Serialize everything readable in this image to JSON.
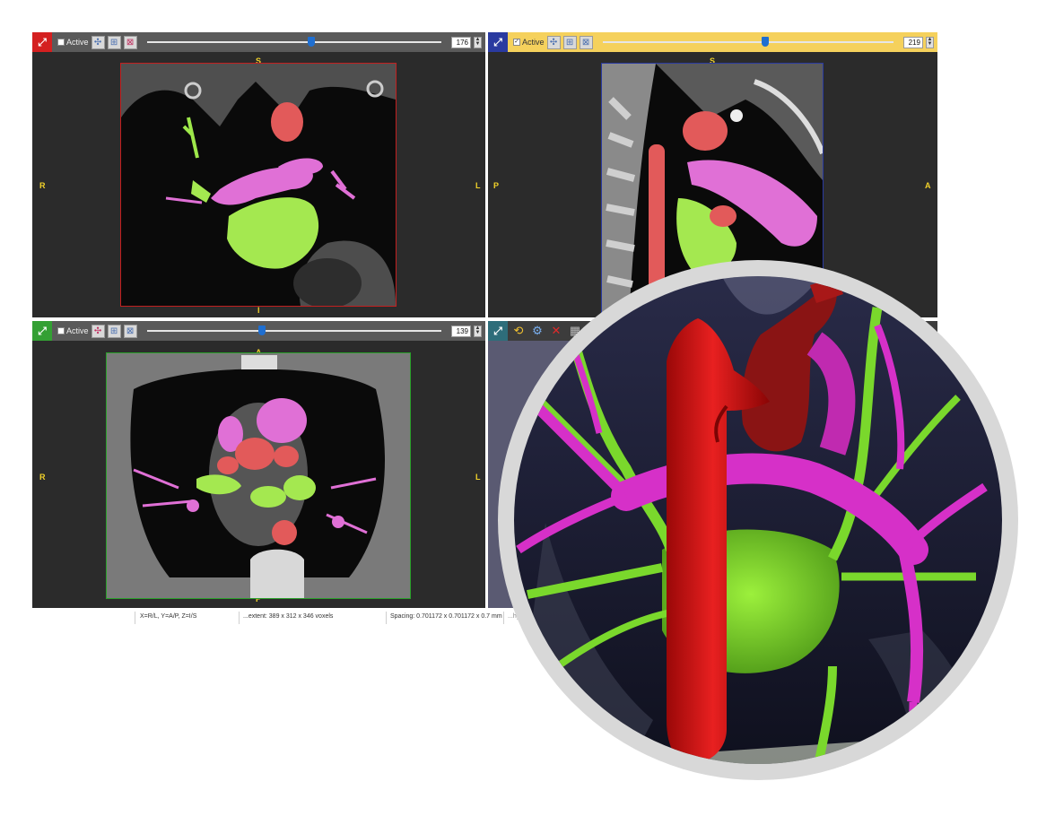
{
  "panels": {
    "axial": {
      "active_label": "Active",
      "active_checked": false,
      "slice_value": "176",
      "slider_fraction": 0.56,
      "orient": {
        "top": "S",
        "bottom": "I",
        "left": "R",
        "right": "L"
      }
    },
    "sagittal": {
      "active_label": "Active",
      "active_checked": true,
      "slice_value": "219",
      "slider_fraction": 0.56,
      "orient": {
        "top": "S",
        "left": "P",
        "right": "A"
      }
    },
    "coronal": {
      "active_label": "Active",
      "active_checked": false,
      "slice_value": "139",
      "slider_fraction": 0.39,
      "orient": {
        "top": "A",
        "bottom": "P",
        "left": "R",
        "right": "L"
      }
    },
    "view3d": {
      "tools": [
        "rotate-icon",
        "settings-icon",
        "delete-icon",
        "grid-icon"
      ]
    }
  },
  "statusbar": {
    "coords": "X=R/L, Y=A/P, Z=I/S",
    "extent": "...extent: 389 x 312 x 346 voxels",
    "spacing": "Spacing: 0.701172 x 0.701172 x 0.7 mm",
    "extra": "...hys"
  },
  "colors": {
    "aorta": "#e02a2a",
    "pulmonary_artery": "#e040c8",
    "pulmonary_vein": "#8ee03a",
    "axial_frame": "#c22020",
    "sagittal_frame": "#2a3aa0",
    "coronal_frame": "#2aa02a",
    "orientation_text": "#f2d22a"
  },
  "icons": {
    "maximize": "maximize-icon",
    "layout": "layout-icon"
  }
}
